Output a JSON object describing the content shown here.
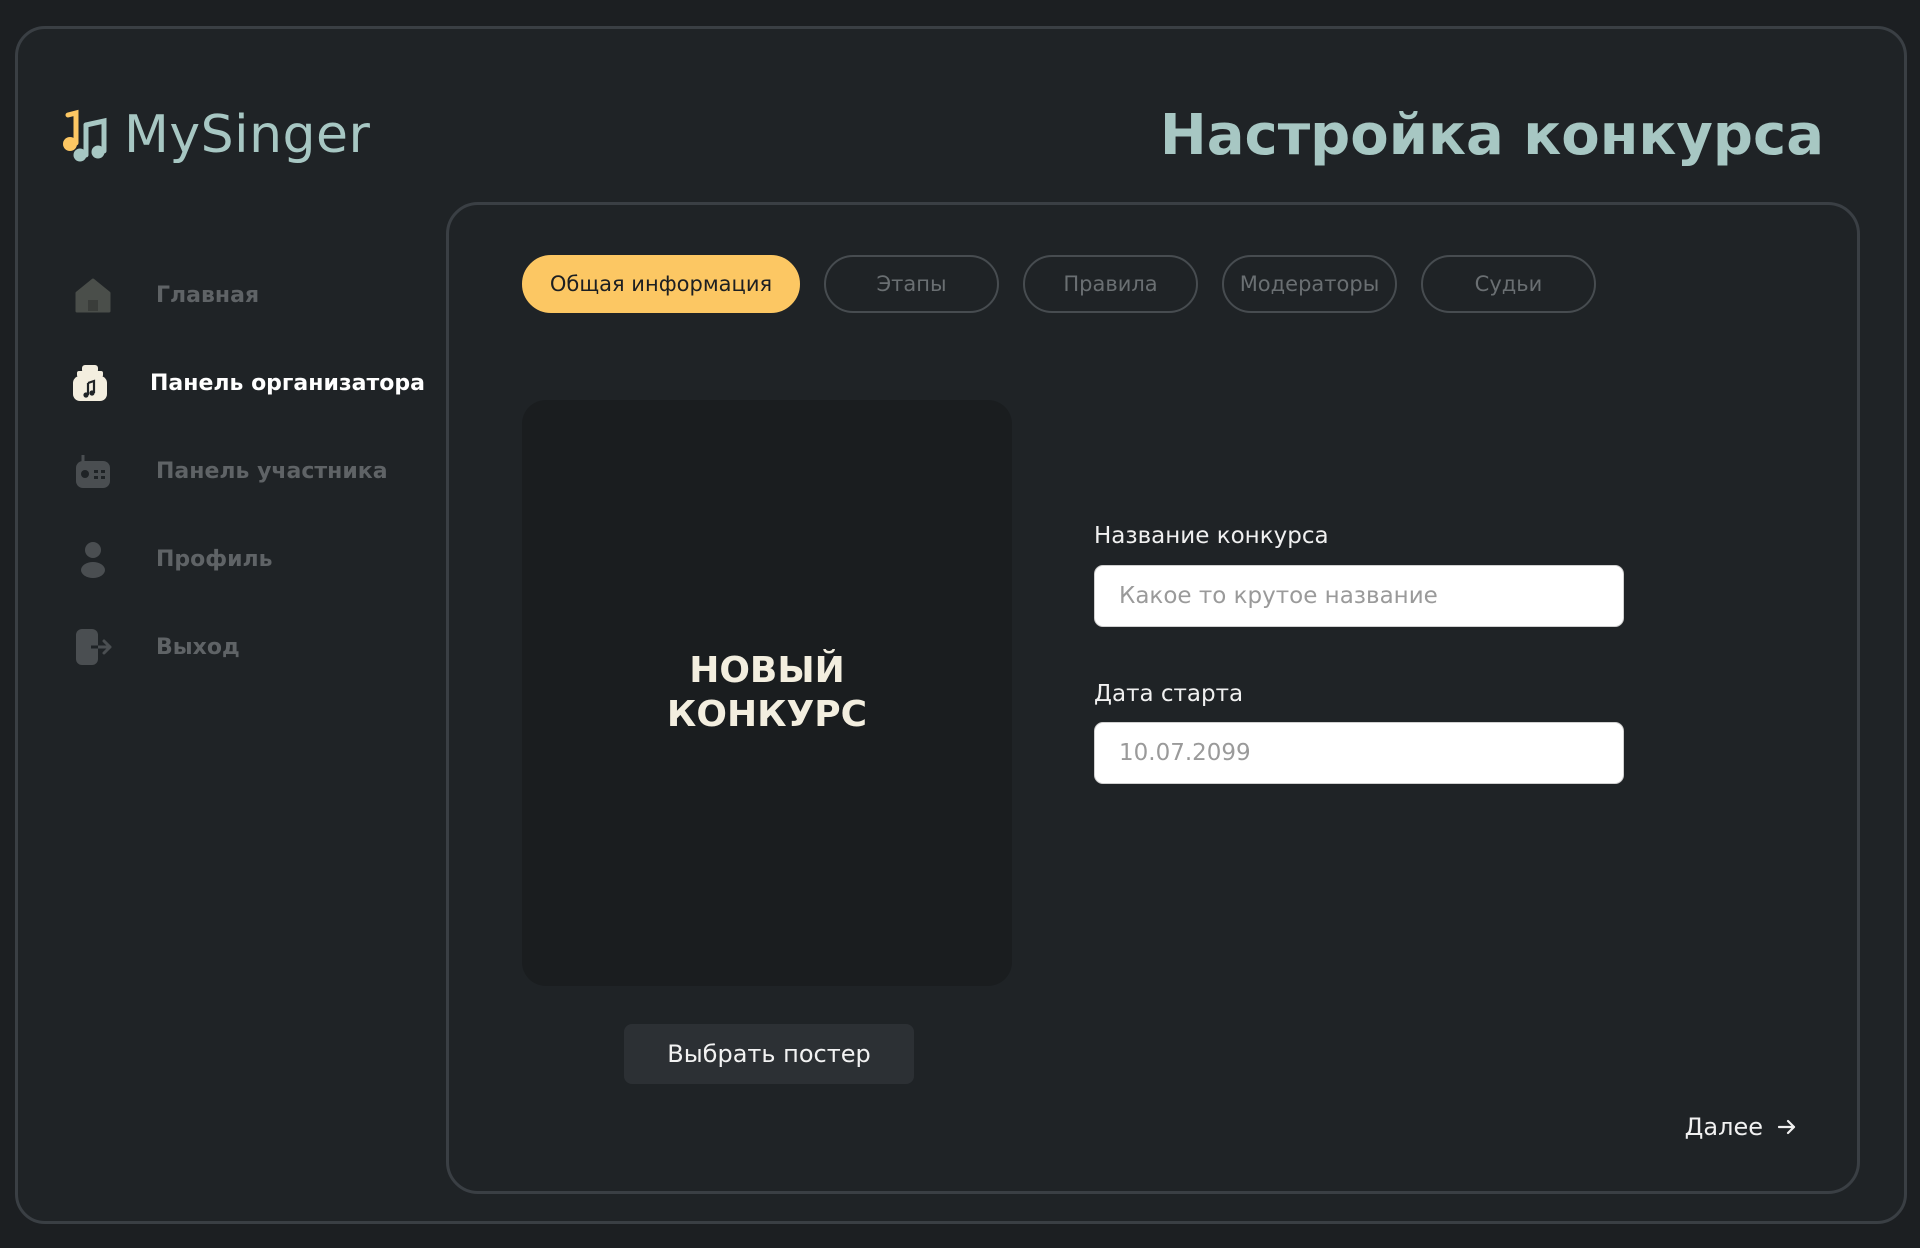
{
  "app": {
    "name": "MySinger",
    "logo_icon": "music-note-icon",
    "accent_color": "#fcc763",
    "title_color": "#a7c7c3"
  },
  "header": {
    "title": "Настройка конкурса"
  },
  "sidebar": {
    "items": [
      {
        "label": "Главная",
        "icon": "home-icon",
        "active": false
      },
      {
        "label": "Панель организатора",
        "icon": "organizer-panel-icon",
        "active": true
      },
      {
        "label": "Панель участника",
        "icon": "radio-icon",
        "active": false
      },
      {
        "label": "Профиль",
        "icon": "user-icon",
        "active": false
      },
      {
        "label": "Выход",
        "icon": "logout-icon",
        "active": false
      }
    ]
  },
  "tabs": [
    {
      "label": "Общая информация",
      "active": true
    },
    {
      "label": "Этапы",
      "active": false
    },
    {
      "label": "Правила",
      "active": false
    },
    {
      "label": "Модераторы",
      "active": false
    },
    {
      "label": "Судьи",
      "active": false
    }
  ],
  "poster": {
    "title": "НОВЫЙ КОНКУРС",
    "button_label": "Выбрать постер"
  },
  "form": {
    "name_label": "Название конкурса",
    "name_placeholder": "Какое то крутое название",
    "date_label": "Дата старта",
    "date_placeholder": "10.07.2099"
  },
  "footer": {
    "next_label": "Далее",
    "next_icon": "arrow-right-icon"
  }
}
